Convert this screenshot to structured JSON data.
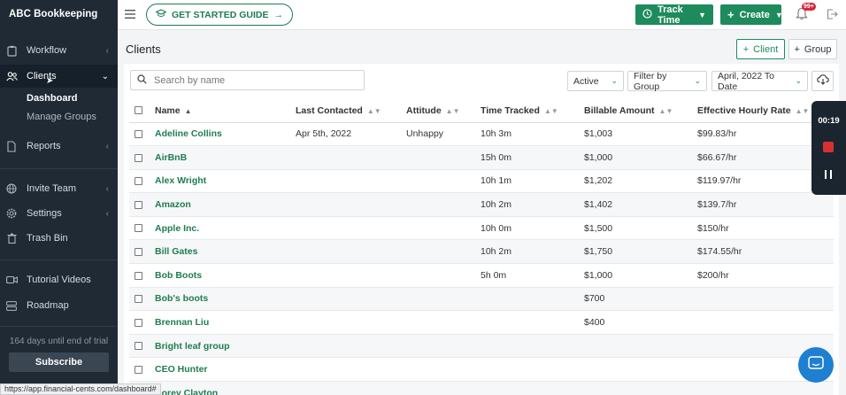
{
  "app": {
    "brand": "ABC Bookkeeping"
  },
  "topbar": {
    "guide_label": "GET STARTED GUIDE",
    "track_time_label": "Track Time",
    "create_label": "Create",
    "notification_badge": "99+"
  },
  "sidebar": {
    "items": [
      {
        "label": "Workflow"
      },
      {
        "label": "Clients"
      },
      {
        "label": "Reports"
      },
      {
        "label": "Invite Team"
      },
      {
        "label": "Settings"
      },
      {
        "label": "Trash Bin"
      },
      {
        "label": "Tutorial Videos"
      },
      {
        "label": "Roadmap"
      }
    ],
    "sub_items": [
      {
        "label": "Dashboard"
      },
      {
        "label": "Manage Groups"
      }
    ],
    "trial_text": "164 days until end of trial",
    "subscribe_label": "Subscribe"
  },
  "main": {
    "title": "Clients",
    "add_client_label": "Client",
    "add_group_label": "Group",
    "search_placeholder": "Search by name",
    "status_filter": "Active",
    "group_filter": "Filter by Group",
    "date_filter": "April, 2022 To Date",
    "columns": [
      "Name",
      "Last Contacted",
      "Attitude",
      "Time Tracked",
      "Billable Amount",
      "Effective Hourly Rate"
    ],
    "rows": [
      {
        "name": "Adeline Collins",
        "last_contacted": "Apr 5th, 2022",
        "attitude": "Unhappy",
        "time": "10h 3m",
        "billable": "$1,003",
        "rate": "$99.83/hr"
      },
      {
        "name": "AirBnB",
        "last_contacted": "",
        "attitude": "",
        "time": "15h 0m",
        "billable": "$1,000",
        "rate": "$66.67/hr"
      },
      {
        "name": "Alex Wright",
        "last_contacted": "",
        "attitude": "",
        "time": "10h 1m",
        "billable": "$1,202",
        "rate": "$119.97/hr"
      },
      {
        "name": "Amazon",
        "last_contacted": "",
        "attitude": "",
        "time": "10h 2m",
        "billable": "$1,402",
        "rate": "$139.7/hr"
      },
      {
        "name": "Apple Inc.",
        "last_contacted": "",
        "attitude": "",
        "time": "10h 0m",
        "billable": "$1,500",
        "rate": "$150/hr"
      },
      {
        "name": "Bill Gates",
        "last_contacted": "",
        "attitude": "",
        "time": "10h 2m",
        "billable": "$1,750",
        "rate": "$174.55/hr"
      },
      {
        "name": "Bob Boots",
        "last_contacted": "",
        "attitude": "",
        "time": "5h 0m",
        "billable": "$1,000",
        "rate": "$200/hr"
      },
      {
        "name": "Bob's boots",
        "last_contacted": "",
        "attitude": "",
        "time": "",
        "billable": "$700",
        "rate": ""
      },
      {
        "name": "Brennan Liu",
        "last_contacted": "",
        "attitude": "",
        "time": "",
        "billable": "$400",
        "rate": ""
      },
      {
        "name": "Bright leaf group",
        "last_contacted": "",
        "attitude": "",
        "time": "",
        "billable": "",
        "rate": ""
      },
      {
        "name": "CEO Hunter",
        "last_contacted": "",
        "attitude": "",
        "time": "",
        "billable": "",
        "rate": ""
      },
      {
        "name": "Corey Clayton",
        "last_contacted": "",
        "attitude": "",
        "time": "",
        "billable": "",
        "rate": ""
      }
    ]
  },
  "timer": {
    "time": "00:19"
  },
  "statusbar": {
    "url": "https://app.financial-cents.com/dashboard#"
  },
  "colors": {
    "sidebar_bg": "#1f2a35",
    "accent_green": "#1e8b5c",
    "link_green": "#1e7d50",
    "badge_red": "#d6263a",
    "chat_blue": "#1f7fd0"
  }
}
